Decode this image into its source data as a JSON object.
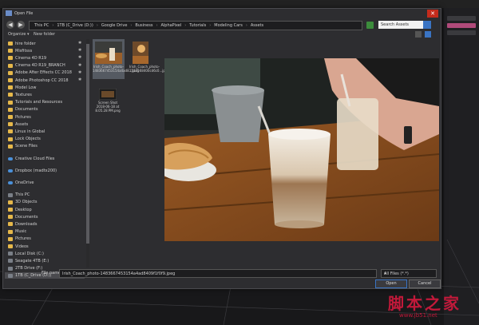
{
  "dialog": {
    "title": "Open File",
    "close_glyph": "✕"
  },
  "nav": {
    "back_glyph": "◀",
    "forward_glyph": "▶",
    "breadcrumbs": [
      "This PC",
      "1TB (C_Drive (D:))",
      "Google Drive",
      "Business",
      "AlphaPixel",
      "Tutorials",
      "Modeling Cars",
      "Assets"
    ],
    "search_placeholder": "Search Assets"
  },
  "toolbar": {
    "organize": "Organize ▾",
    "new_folder": "New folder"
  },
  "sidebar": {
    "items": [
      {
        "label": "hire folder",
        "icon": "folder",
        "pinned": true
      },
      {
        "label": "Misfitsss",
        "icon": "folder",
        "pinned": true
      },
      {
        "label": "Cinema 4D R19",
        "icon": "folder",
        "pinned": true
      },
      {
        "label": "Cinema 4D R19_BRANCH",
        "icon": "folder",
        "pinned": true
      },
      {
        "label": "Adobe After Effects CC 2018",
        "icon": "folder",
        "pinned": true
      },
      {
        "label": "Adobe Photoshop CC 2018",
        "icon": "folder",
        "pinned": true
      },
      {
        "label": "Model Low",
        "icon": "folder",
        "pinned": false
      },
      {
        "label": "Textures",
        "icon": "folder",
        "pinned": false
      },
      {
        "label": "Tutorials and Resources",
        "icon": "folder",
        "pinned": false
      },
      {
        "label": "Documents",
        "icon": "folder",
        "pinned": false
      },
      {
        "label": "Pictures",
        "icon": "folder",
        "pinned": false
      },
      {
        "label": "Assets",
        "icon": "folder",
        "pinned": false
      },
      {
        "label": "Linux in Global",
        "icon": "folder",
        "pinned": false
      },
      {
        "label": "Lock Objects",
        "icon": "folder",
        "pinned": false
      },
      {
        "label": "Scene Files",
        "icon": "folder",
        "pinned": false
      },
      {
        "label": "Creative Cloud Files",
        "icon": "cloud",
        "pinned": false
      },
      {
        "label": "Dropbox (madtx200)",
        "icon": "cloud",
        "pinned": false
      },
      {
        "label": "OneDrive",
        "icon": "cloud",
        "pinned": false
      },
      {
        "label": "This PC",
        "icon": "drive",
        "pinned": false
      },
      {
        "label": "3D Objects",
        "icon": "folder",
        "pinned": false
      },
      {
        "label": "Desktop",
        "icon": "folder",
        "pinned": false
      },
      {
        "label": "Documents",
        "icon": "folder",
        "pinned": false
      },
      {
        "label": "Downloads",
        "icon": "folder",
        "pinned": false
      },
      {
        "label": "Music",
        "icon": "folder",
        "pinned": false
      },
      {
        "label": "Pictures",
        "icon": "folder",
        "pinned": false
      },
      {
        "label": "Videos",
        "icon": "folder",
        "pinned": false
      },
      {
        "label": "Local Disk (C:)",
        "icon": "drive",
        "pinned": false
      },
      {
        "label": "Seagate 4TB (E:)",
        "icon": "drive",
        "pinned": false
      },
      {
        "label": "2TB Drive (F:)",
        "icon": "drive",
        "pinned": false
      },
      {
        "label": "1TB (C_Drive (D:))",
        "icon": "drive",
        "pinned": false,
        "selected": true
      }
    ],
    "pin_glyph": "✱"
  },
  "files": [
    {
      "name": "Irish_Coach_photo-1483667453154a4ad8...jpeg",
      "selected": true
    },
    {
      "name": "Irish_Coach_photo-1512568400cd6c0...jpeg",
      "selected": false
    },
    {
      "name": "Screen Shot 2018-06-18 at 8.05.28 PM.png",
      "selected": false
    }
  ],
  "bottom": {
    "file_name_label": "File name:",
    "file_name_value": "Irish_Coach_photo-1483667453154a4ad8409f1f0f9.jpeg",
    "file_type": "All Files (*.*)",
    "open_label": "Open",
    "cancel_label": "Cancel"
  },
  "watermark": {
    "main": "脚本之家",
    "sub": "www.jb51.net"
  },
  "colors": {
    "dialog_bg": "#2d2d30",
    "close_red": "#c42b1c",
    "folder_yellow": "#e6b84a",
    "accent_blue": "#3a74c4",
    "watermark_red": "#c2193a"
  }
}
